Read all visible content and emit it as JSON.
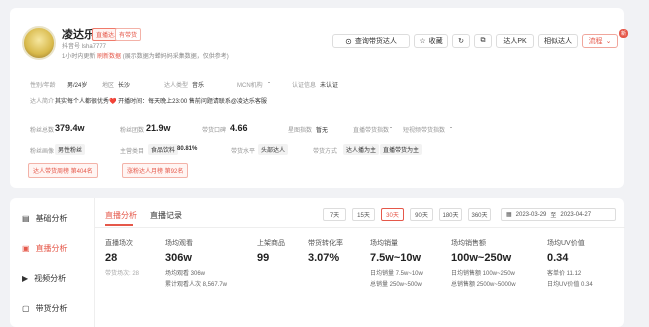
{
  "profile": {
    "name": "凌达乐",
    "tag1": "直播达人",
    "tag2": "有带货",
    "account": "抖音号 lsha7777",
    "update": "1小时内更新",
    "update_link": "刷新数据",
    "update_note": "(展示数据为蝉妈妈采集数据，仅供参考)",
    "follow_btn": "查询带货达人",
    "collect_btn": "收藏",
    "pk_btn": "达人PK",
    "similar_btn": "相似达人",
    "more_btn": "流程",
    "badge": "新",
    "gender_label": "性别/年龄",
    "gender_val": "男/24岁",
    "region_label": "地区",
    "region_val": "长沙",
    "type_label": "达人类型",
    "type_val": "音乐",
    "mcn_label": "MCN机构",
    "mcn_val": "-",
    "auth_label": "认证信息",
    "auth_val": "未认证",
    "intro_label": "达人简介",
    "intro_val": "其实每个人都很优秀❤️ 开播时间：每天晚上23:00 售前问题请联系@凌达乐客服",
    "fans_label": "粉丝总数",
    "fans_val": "379.4w",
    "group_label": "粉丝团数",
    "group_val": "21.9w",
    "reputation_label": "带货口碑",
    "reputation_val": "4.66",
    "level_label": "星图指数",
    "level_val": "暂无",
    "live_label": "直播带货指数",
    "live_val": "-",
    "video_label": "短视频带货指数",
    "video_val": "-",
    "goods_label": "粉丝画像",
    "goods_val": "男性粉丝",
    "main_label": "主营类目",
    "main_val": "食品饮料",
    "main_pct": "80.81%",
    "style_label": "带货水平",
    "style_val": "头部达人",
    "method_label": "带货方式",
    "method_val1": "达人播为主",
    "method_val2": "直播带货为主",
    "rank1": "达人带货周榜 第404名",
    "rank2": "涨粉达人月榜 第92名"
  },
  "sidebar": {
    "items": [
      {
        "label": "基础分析",
        "icon": "doc-icon"
      },
      {
        "label": "直播分析",
        "icon": "live-icon"
      },
      {
        "label": "视频分析",
        "icon": "video-icon"
      },
      {
        "label": "带货分析",
        "icon": "cart-icon"
      }
    ]
  },
  "main": {
    "tab1": "直播分析",
    "tab2": "直播记录",
    "ranges": [
      "7天",
      "15天",
      "30天",
      "90天",
      "180天",
      "360天"
    ],
    "date_start": "2023-03-29",
    "date_sep": "至",
    "date_end": "2023-04-27",
    "metrics": [
      {
        "label": "直播场次",
        "value": "28",
        "sub1": "带货场次: 28",
        "sub2": ""
      },
      {
        "label": "场均观看",
        "value": "306w",
        "sub1": "场均观看  306w",
        "sub2": "累计观看人次  8,567.7w"
      },
      {
        "label": "上架商品",
        "value": "99",
        "sub1": "",
        "sub2": ""
      },
      {
        "label": "带货转化率",
        "value": "3.07%",
        "sub1": "",
        "sub2": ""
      },
      {
        "label": "场均销量",
        "value": "7.5w~10w",
        "sub1": "日均销量  7.5w~10w",
        "sub2": "总销量  250w~500w"
      },
      {
        "label": "场均销售额",
        "value": "100w~250w",
        "sub1": "日均销售额  100w~250w",
        "sub2": "总销售额  2500w~5000w"
      },
      {
        "label": "场均UV价值",
        "value": "0.34",
        "sub1": "客单价  11.12",
        "sub2": "日均UV价值  0.34"
      }
    ]
  }
}
